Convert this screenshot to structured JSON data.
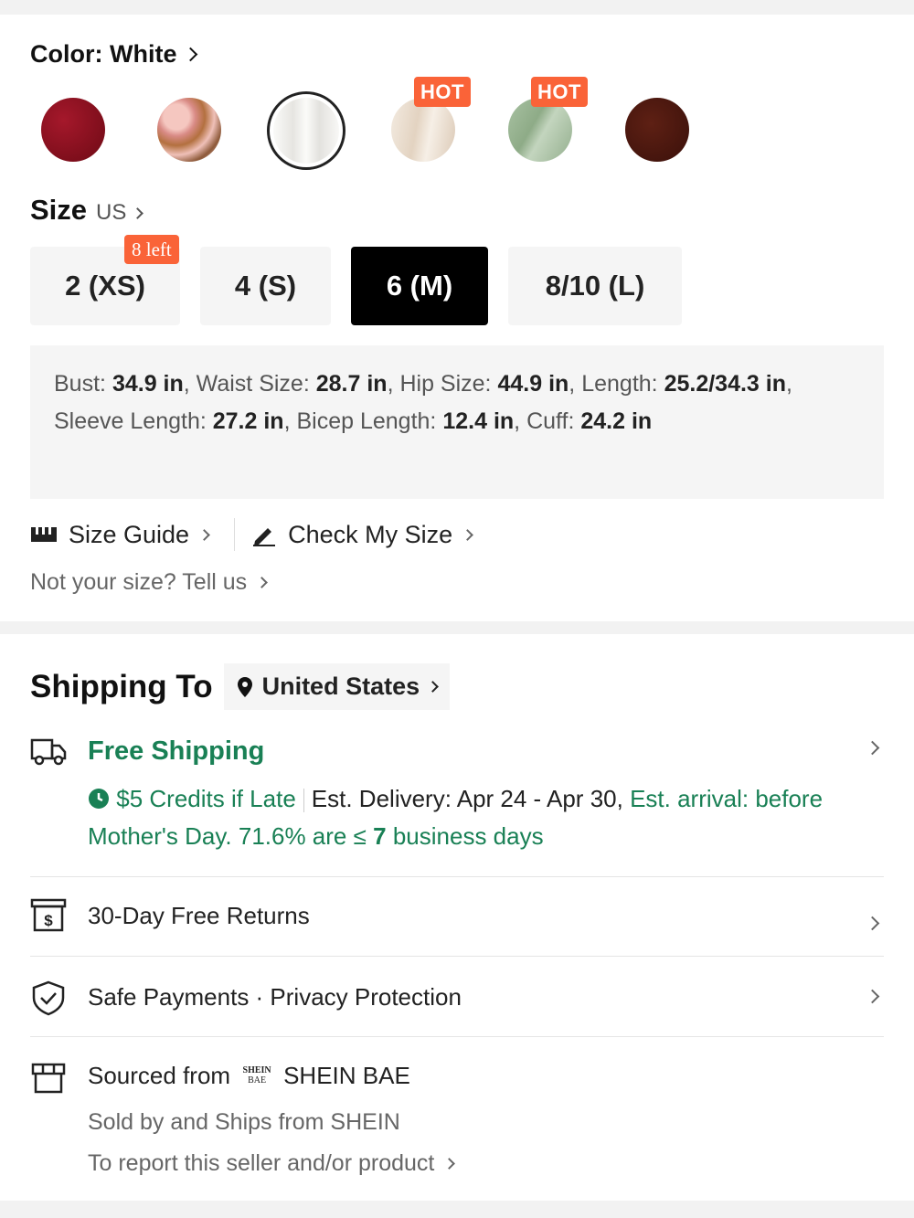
{
  "color": {
    "label": "Color: White",
    "swatches": [
      {
        "name": "burgundy",
        "color": "#8c0f1e",
        "hot": false
      },
      {
        "name": "pink-floral",
        "color": "#e8a6a6",
        "hot": false
      },
      {
        "name": "white",
        "color": "#f4f3f0",
        "hot": false,
        "selected": true
      },
      {
        "name": "cream-floral",
        "color": "#ece0d2",
        "hot": true
      },
      {
        "name": "sage-green",
        "color": "#9fb89a",
        "hot": true
      },
      {
        "name": "brown",
        "color": "#4a1810",
        "hot": false
      }
    ],
    "hot_label": "HOT"
  },
  "size": {
    "label": "Size",
    "unit": "US",
    "options": [
      "2 (XS)",
      "4 (S)",
      "6 (M)",
      "8/10 (L)"
    ],
    "selected": "6 (M)",
    "stock_badge": "8 left",
    "measurements": {
      "bust_label": "Bust:",
      "bust": "34.9 in",
      "waist_label": "Waist Size:",
      "waist": "28.7 in",
      "hip_label": "Hip Size:",
      "hip": "44.9 in",
      "length_label": "Length:",
      "length": "25.2/34.3 in",
      "sleeve_label": "Sleeve Length:",
      "sleeve": "27.2 in",
      "bicep_label": "Bicep Length:",
      "bicep": "12.4 in",
      "cuff_label": "Cuff:",
      "cuff": "24.2 in"
    },
    "size_guide": "Size Guide",
    "check_size": "Check My Size",
    "not_your_size": "Not your size? Tell us"
  },
  "shipping": {
    "title": "Shipping To",
    "country": "United States",
    "free_shipping": "Free Shipping",
    "credits": "$5 Credits if Late",
    "est_delivery": "Est. Delivery: Apr 24 - Apr 30,",
    "est_arrival": "Est. arrival: before Mother's Day. 71.6% are ≤",
    "days_num": "7",
    "days_suffix": "business days",
    "returns": "30-Day Free Returns",
    "payments": "Safe Payments · Privacy Protection",
    "sourced_from": "Sourced from",
    "brand": "SHEIN BAE",
    "logo_top": "SHEIN",
    "logo_bottom": "BAE",
    "sold_by": "Sold by and Ships from SHEIN",
    "report": "To report this seller and/or product"
  },
  "colors": {
    "accent_orange": "#fa6338",
    "green": "#198055"
  }
}
